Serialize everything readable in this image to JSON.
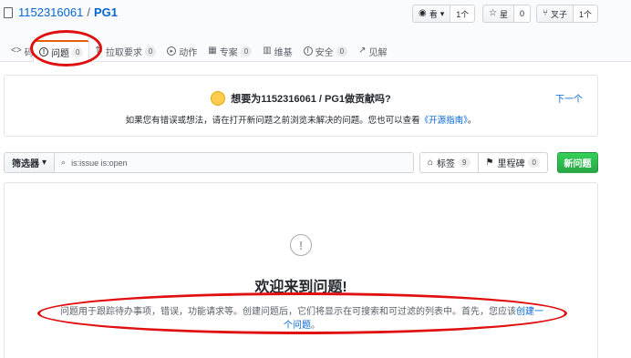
{
  "repo": {
    "owner": "1152316061",
    "separator": "/",
    "name": "PG1"
  },
  "actions": {
    "watch": {
      "label": "看",
      "count": "1个"
    },
    "star": {
      "label": "星",
      "count": "0"
    },
    "fork": {
      "label": "叉子",
      "count": "1个"
    }
  },
  "tabs": [
    {
      "label": "码",
      "count": ""
    },
    {
      "label": "问题",
      "count": "0"
    },
    {
      "label": "拉取要求",
      "count": "0"
    },
    {
      "label": "动作",
      "count": ""
    },
    {
      "label": "专案",
      "count": "0"
    },
    {
      "label": "维基",
      "count": ""
    },
    {
      "label": "安全",
      "count": "0"
    },
    {
      "label": "见解",
      "count": ""
    }
  ],
  "contribute": {
    "title": "想要为1152316061 / PG1做贡献吗?",
    "desc_prefix": "如果您有错误或想法，请在打开新问题之前浏览未解决的问题。您也可以查看",
    "desc_link": "《开源指南》",
    "desc_suffix": "。",
    "next": "下一个"
  },
  "filter": {
    "button": "筛选器",
    "search_value": "is:issue is:open",
    "labels": {
      "label": "标签",
      "count": "9"
    },
    "milestones": {
      "label": "里程碑",
      "count": "0"
    },
    "new_issue": "新问题"
  },
  "blankslate": {
    "title": "欢迎来到问题!",
    "desc_prefix": "问题用于跟踪待办事项，错误，功能请求等。创建问题后，它们将显示在可搜索和可过滤的列表中。首先，您应该",
    "desc_link": "创建一个问题",
    "desc_suffix": "。"
  },
  "colors": {
    "annotation": "#e01010",
    "link": "#0366d6",
    "primary": "#28a745"
  },
  "icons": {
    "repo": "book-icon",
    "watch": "eye-icon",
    "star": "star-icon",
    "fork": "fork-icon",
    "issue": "issue-opened-icon",
    "search": "search-icon",
    "label": "tag-icon",
    "milestone": "milestone-icon"
  }
}
